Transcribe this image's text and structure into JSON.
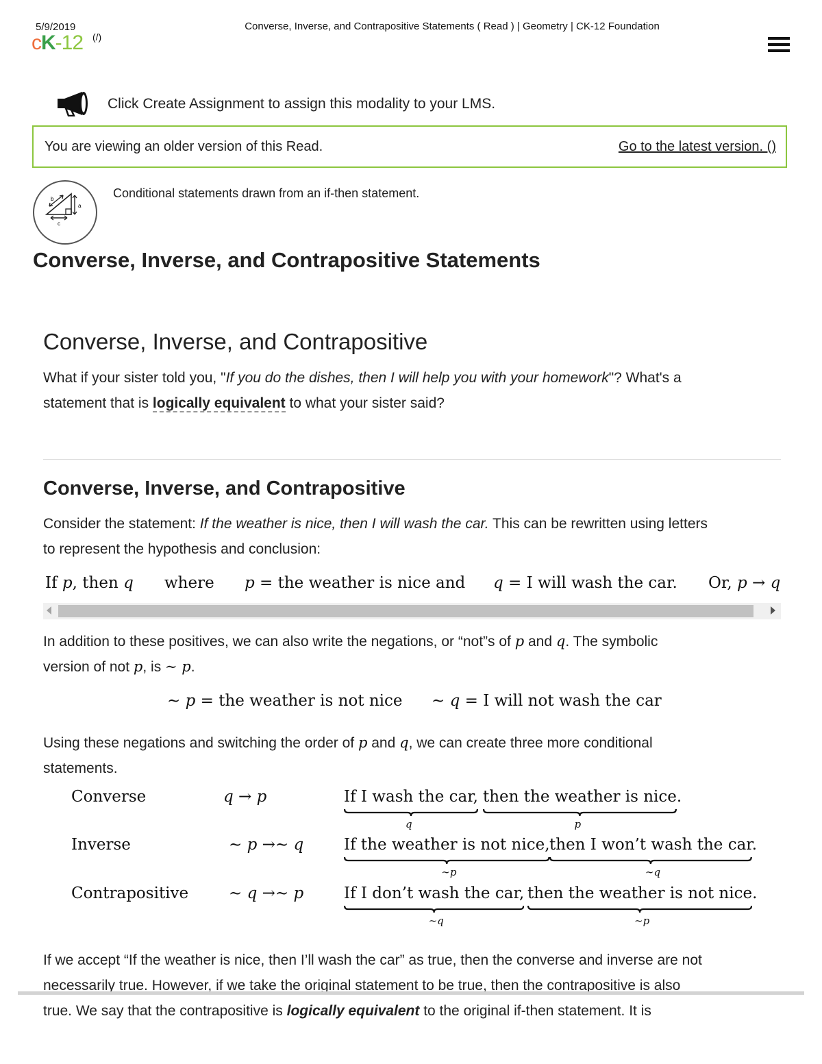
{
  "header": {
    "date": "5/9/2019",
    "page_title": "Converse, Inverse, and Contrapositive Statements ( Read ) | Geometry | CK-12 Foundation",
    "logo": {
      "c": "c",
      "k": "K",
      "n": "-12",
      "link": "(/)"
    },
    "menu_icon": "hamburger-menu-icon"
  },
  "notice": {
    "icon": "megaphone-icon",
    "text": "Click Create Assignment to assign this modality to your LMS."
  },
  "version_banner": {
    "text": "You are viewing an older version of this Read.",
    "link": "Go to the latest version. ()",
    "border_color": "#8cc63f"
  },
  "concept": {
    "icon": "right-triangle-icon",
    "icon_labels": {
      "a": "a",
      "b": "b",
      "c": "c"
    },
    "description": "Conditional statements drawn from an if-then statement.",
    "title": "Converse, Inverse, and Contrapositive Statements"
  },
  "intro": {
    "heading": "Converse, Inverse, and Contrapositive",
    "p1_before": "What if your sister told you, \"",
    "p1_italic": "If you do the dishes, then I will help you with your homework",
    "p1_after": "\"? What's a",
    "p2_before": "statement that is ",
    "p2_term": "logically equivalent",
    "p2_after": " to what your sister said?"
  },
  "section": {
    "heading": "Converse, Inverse, and Contrapositive",
    "consider_before": "Consider the statement: ",
    "consider_italic": "If the weather is nice, then I will wash the car.",
    "consider_after": " This can be rewritten using letters",
    "consider_line2": "to represent the hypothesis and conclusion:",
    "math_row": {
      "if_p_then_q": [
        "If ",
        "p",
        ", then ",
        "q"
      ],
      "where": "where",
      "p_def": [
        "p",
        " = the weather is nice and"
      ],
      "q_def": [
        "q",
        " = I will wash the car."
      ],
      "or": [
        "Or, ",
        "p",
        " → ",
        "q"
      ]
    },
    "neg_line1_before": "In addition to these positives, we can also write the negations, or “not”s of ",
    "neg_p": "p",
    "neg_and": " and ",
    "neg_q": "q",
    "neg_line1_after": ". The symbolic",
    "neg_line2_before": "version of not ",
    "neg_line2_p": "p",
    "neg_line2_mid": ", is ",
    "neg_line2_sym": "∼ p",
    "neg_line2_end": ".",
    "neg_defs": {
      "p": [
        "∼ ",
        "p",
        " = the weather is not nice"
      ],
      "q": [
        "∼ ",
        "q",
        " = I will not wash the car"
      ]
    },
    "using_before": "Using these negations and switching the order of ",
    "using_p": "p",
    "using_and": " and ",
    "using_q": "q",
    "using_after": ", we can create three more conditional",
    "using_line2": "statements.",
    "statements": [
      {
        "name": "Converse",
        "symbol": "q → p",
        "part1": "If I wash the car,",
        "label1": "q",
        "part2": "then the weather is nice",
        "end": ".",
        "label2": "p"
      },
      {
        "name": "Inverse",
        "symbol": "∼ p →∼ q",
        "part1": "If the weather is not nice,",
        "label1": "∼p",
        "part2": "then I won’t wash the car",
        "end": ".",
        "label2": "∼q"
      },
      {
        "name": "Contrapositive",
        "symbol": "∼ q →∼ p",
        "part1": "If I don’t wash the car,",
        "label1": "∼q",
        "part2": "then the weather is not nice",
        "end": ".",
        "label2": "∼p"
      }
    ],
    "closing_line1": "If we accept “If the weather is nice, then I’ll wash the car” as true, then the converse and inverse are not",
    "closing_line2": "necessarily true. However, if we take the original statement to be true, then the contrapositive is also",
    "closing_line3_before": "true. We say that the contrapositive is ",
    "closing_line3_term": "logically equivalent",
    "closing_line3_after": " to the original if-then statement. It is"
  }
}
